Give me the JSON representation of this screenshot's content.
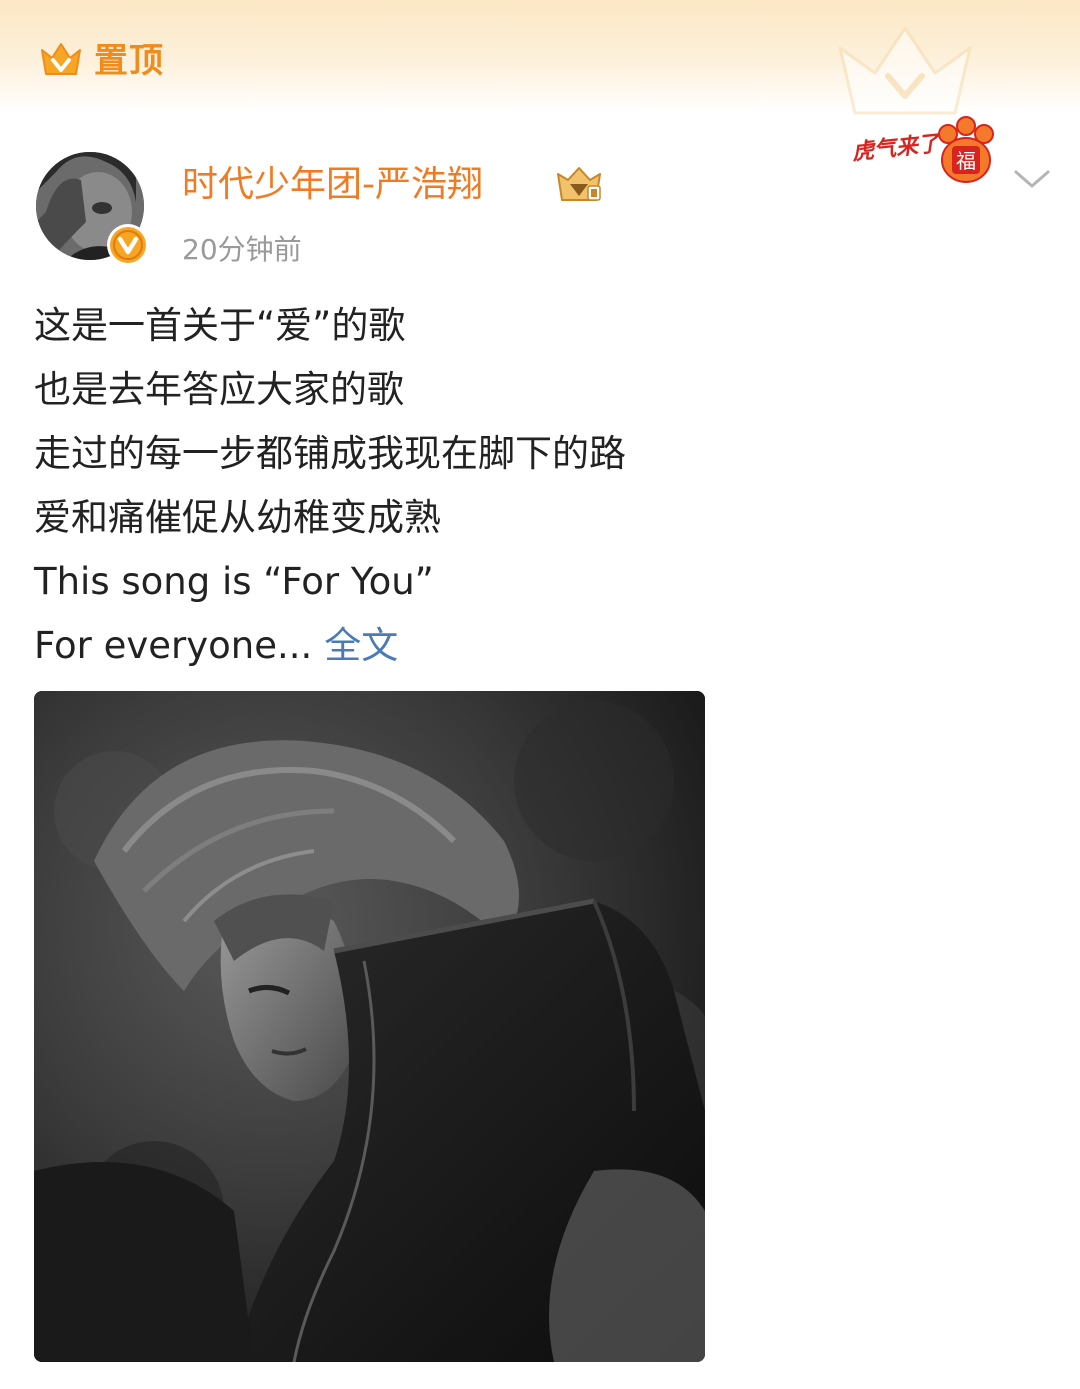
{
  "pin": {
    "label": "置顶",
    "icon": "crown-icon",
    "color": "#f08c1e"
  },
  "user": {
    "name": "时代少年团-严浩翔",
    "name_color": "#f07b22",
    "time": "20分钟前",
    "verified_icon": "verified-v-icon",
    "member_icon": "diamond-member-icon"
  },
  "stamp": {
    "text": "虎气来了",
    "icon": "tiger-paw-icon",
    "paw_char": "福"
  },
  "menu": {
    "icon": "chevron-down-icon"
  },
  "post": {
    "lines": [
      "这是一首关于“爱”的歌",
      "也是去年答应大家的歌",
      "走过的每一步都铺成我现在脚下的路",
      "爱和痛催促从幼稚变成熟",
      "This song is “For You”",
      "For everyone..."
    ],
    "read_more": "全文",
    "link_color": "#4a7bb5"
  },
  "image": {
    "description_icon": "photo"
  }
}
